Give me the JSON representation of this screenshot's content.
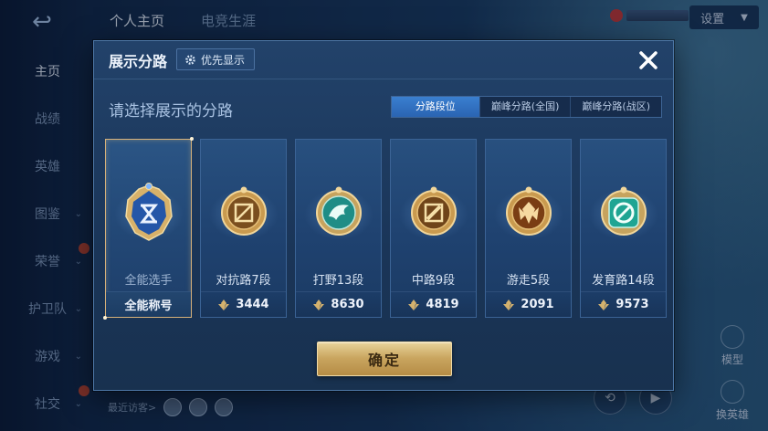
{
  "background": {
    "tabs": [
      "个人主页",
      "电竞生涯"
    ],
    "settings_label": "设置",
    "sidebar": [
      {
        "label": "主页",
        "active": true,
        "chevron": false,
        "new": false
      },
      {
        "label": "战绩",
        "active": false,
        "chevron": false,
        "new": false
      },
      {
        "label": "英雄",
        "active": false,
        "chevron": false,
        "new": false
      },
      {
        "label": "图鉴",
        "active": false,
        "chevron": true,
        "new": false
      },
      {
        "label": "荣誉",
        "active": false,
        "chevron": true,
        "new": true
      },
      {
        "label": "护卫队",
        "active": false,
        "chevron": true,
        "new": false
      },
      {
        "label": "游戏",
        "active": false,
        "chevron": true,
        "new": false
      },
      {
        "label": "社交",
        "active": false,
        "chevron": true,
        "new": true
      }
    ],
    "recent_visitors_label": "最近访客>",
    "model_label": "模型",
    "switch_hero_label": "换英雄"
  },
  "modal": {
    "title": "展示分路",
    "priority_label": "优先显示",
    "subtitle": "请选择展示的分路",
    "tabs": [
      {
        "label": "分路段位",
        "active": true
      },
      {
        "label": "巅峰分路(全国)",
        "active": false
      },
      {
        "label": "巅峰分路(战区)",
        "active": false
      }
    ],
    "cards": [
      {
        "id": "all",
        "label": "全能选手",
        "footer": "全能称号",
        "selected": true,
        "badge": "all-rounder-badge-icon"
      },
      {
        "id": "clash",
        "label": "对抗路7段",
        "score": "3444",
        "selected": false,
        "badge": "clash-lane-badge-icon"
      },
      {
        "id": "jungle",
        "label": "打野13段",
        "score": "8630",
        "selected": false,
        "badge": "jungle-badge-icon"
      },
      {
        "id": "mid",
        "label": "中路9段",
        "score": "4819",
        "selected": false,
        "badge": "mid-lane-badge-icon"
      },
      {
        "id": "roam",
        "label": "游走5段",
        "score": "2091",
        "selected": false,
        "badge": "roam-badge-icon"
      },
      {
        "id": "farm",
        "label": "发育路14段",
        "score": "9573",
        "selected": false,
        "badge": "farm-lane-badge-icon"
      }
    ],
    "confirm_label": "确定"
  },
  "colors": {
    "accent_blue": "#2f6fc0",
    "gold": "#c9a55f",
    "jade": "#2fb8a6"
  }
}
